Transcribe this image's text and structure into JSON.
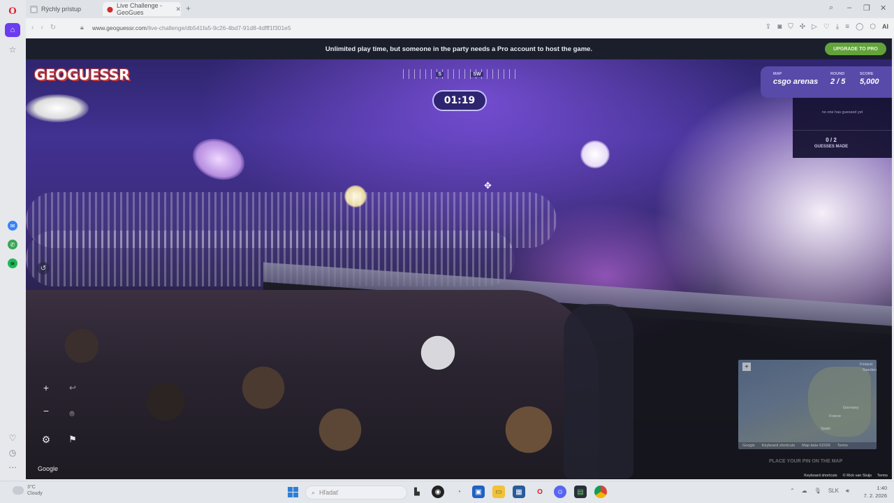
{
  "browser": {
    "tabs": [
      {
        "label": "Rýchly prístup"
      },
      {
        "label": "Live Challenge - GeoGues"
      }
    ],
    "new_tab": "+",
    "url": {
      "host": "www.geoguessr.com",
      "path": "/live-challenge/db541fa5-9c26-4bd7-91d8-4dfff1f301e5"
    },
    "ai_label": "AI"
  },
  "game": {
    "banner_text": "Unlimited play time, but someone in the party needs a Pro account to host the game.",
    "upgrade_label": "UPGRADE TO PRO",
    "logo": "GEOGUESSR",
    "compass": {
      "left": "S",
      "right": "SW"
    },
    "timer": "01:19",
    "status": {
      "map_label": "MAP",
      "map_value": "csgo arenas",
      "round_label": "ROUND",
      "round_value": "2 / 5",
      "score_label": "SCORE",
      "score_value": "5,000"
    },
    "guesses": {
      "none_text": "no one has guessed yet",
      "count": "0 / 2",
      "label": "GUESSES MADE"
    },
    "google_logo": "Google",
    "minimap": {
      "labels": [
        "Sweden",
        "Finland",
        "Germany",
        "France",
        "Spain"
      ],
      "footer_google": "Google",
      "footer_shortcuts": "Keyboard shortcuts",
      "footer_mapdata": "Map data ©2026",
      "footer_terms": "Terms"
    },
    "place_pin": "PLACE YOUR PIN ON THE MAP",
    "attribution": {
      "shortcuts": "Keyboard shortcuts",
      "author": "© Rick van Sluijs",
      "terms": "Terms"
    }
  },
  "taskbar": {
    "weather_temp": "3°C",
    "weather_desc": "Cloudy",
    "search_placeholder": "Hľadať",
    "lang": "SLK",
    "time": "1:40",
    "date": "7. 2. 2026"
  },
  "colors": {
    "opera_red": "#e01b24",
    "opera_accent": "#6b3cf0",
    "upgrade_green": "#62a33a",
    "status_purple": "#574aa8"
  }
}
